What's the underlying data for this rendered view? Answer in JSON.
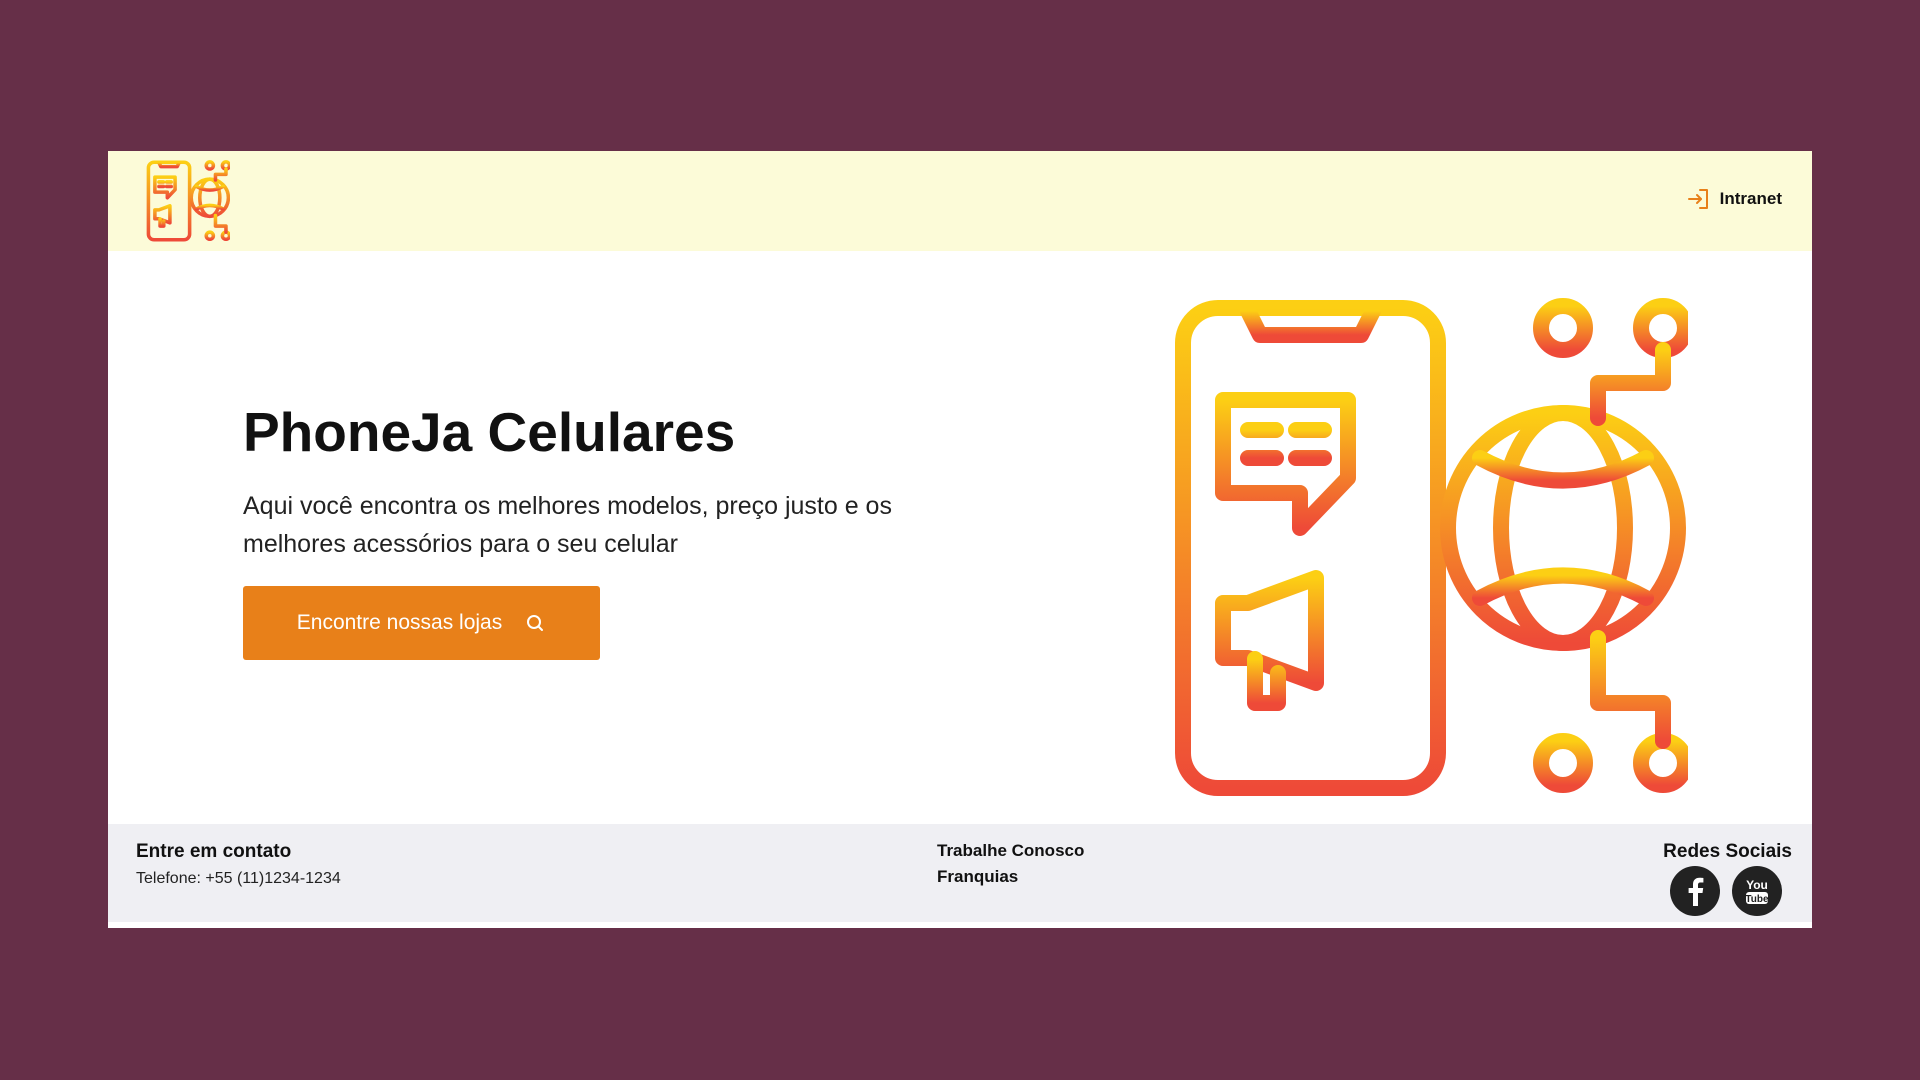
{
  "header": {
    "logo": "phone-globe-logo",
    "intranet_label": "Intranet",
    "intranet_icon": "login-arrow-icon"
  },
  "hero": {
    "title": "PhoneJa Celulares",
    "subtitle": "Aqui você encontra os melhores modelos, preço justo e os melhores acessórios para o seu celular",
    "cta_label": "Encontre nossas lojas",
    "cta_icon": "search-icon",
    "illustration": "phone-chat-megaphone-globe-network-icon"
  },
  "footer": {
    "contact_title": "Entre em contato",
    "contact_phone": "Telefone: +55 (11)1234-1234",
    "links": [
      "Trabalhe Conosco",
      "Franquias"
    ],
    "social_title": "Redes Sociais",
    "social_icons": [
      "facebook-icon",
      "youtube-icon"
    ]
  },
  "colors": {
    "page_background": "#662f48",
    "header_background": "#fcfbd8",
    "footer_background": "#efeff3",
    "accent": "#e88019",
    "gradient_top": "#fccf14",
    "gradient_bottom": "#ee4a38"
  }
}
